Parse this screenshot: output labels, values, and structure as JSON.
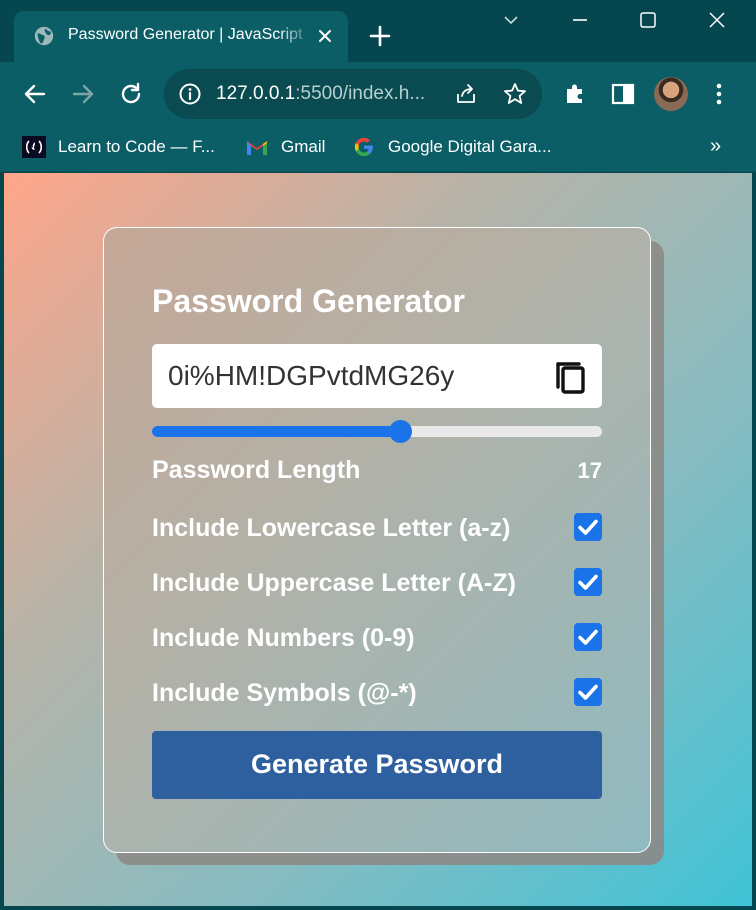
{
  "browser": {
    "tab": {
      "title": "Password Generator | JavaScript",
      "icon": "globe-icon"
    },
    "address": {
      "host": "127.0.0.1",
      "rest": ":5500/index.h..."
    },
    "bookmarks": [
      {
        "label": "Learn to Code — F...",
        "icon": "freecodecamp-icon"
      },
      {
        "label": "Gmail",
        "icon": "gmail-icon"
      },
      {
        "label": "Google Digital Gara...",
        "icon": "google-icon"
      }
    ],
    "bookmarks_overflow": "»"
  },
  "app": {
    "title": "Password Generator",
    "password": "0i%HM!DGPvtdMG26y",
    "length_label": "Password Length",
    "length_value": "17",
    "slider": {
      "min": 1,
      "max": 30,
      "value": 17
    },
    "options": [
      {
        "label": "Include Lowercase Letter (a-z)",
        "checked": true
      },
      {
        "label": "Include Uppercase Letter (A-Z)",
        "checked": true
      },
      {
        "label": "Include Numbers (0-9)",
        "checked": true
      },
      {
        "label": "Include Symbols (@-*)",
        "checked": true
      }
    ],
    "generate_label": "Generate Password"
  },
  "colors": {
    "accent": "#1a73e8",
    "button": "#2e5f9e",
    "chrome": "#0b5e66",
    "gradient_start": "#ffa68a",
    "gradient_end": "#3fc3d6"
  }
}
